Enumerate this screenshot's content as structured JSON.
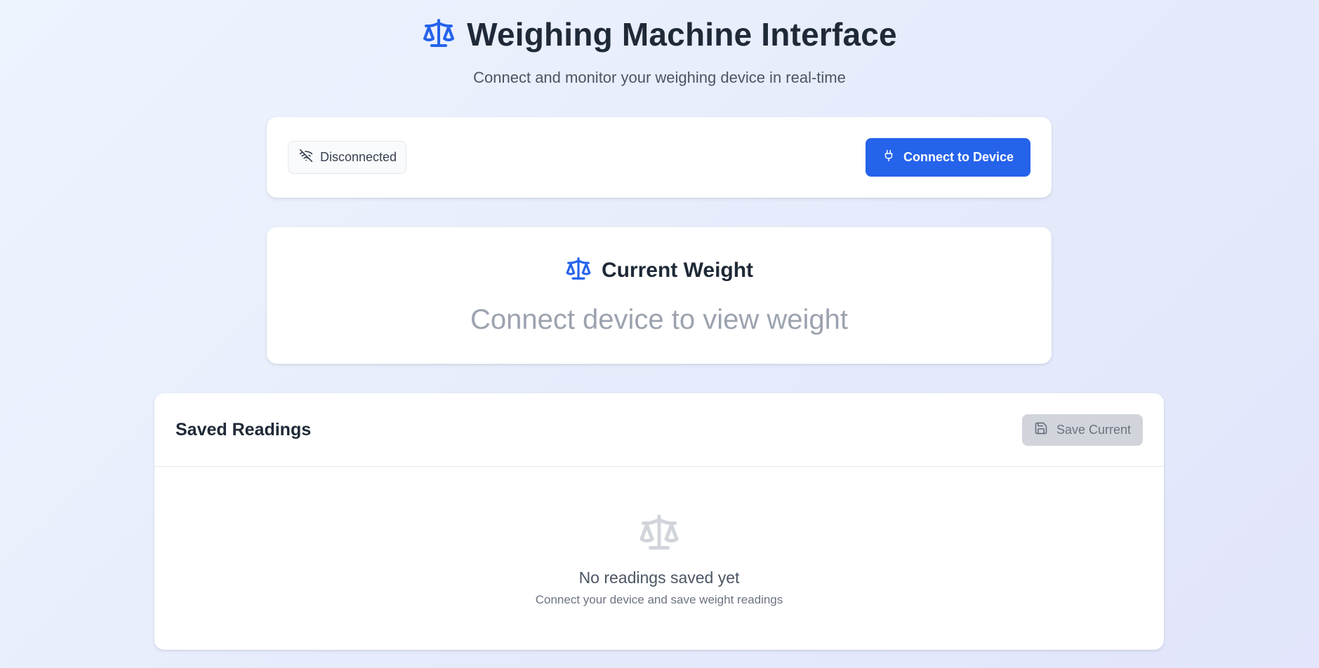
{
  "header": {
    "title": "Weighing Machine Interface",
    "subtitle": "Connect and monitor your weighing device in real-time",
    "icon": "scale-icon"
  },
  "connection": {
    "status": "Disconnected",
    "status_icon": "wifi-off-icon",
    "connect_label": "Connect to Device",
    "connect_icon": "plug-icon"
  },
  "weight": {
    "title": "Current Weight",
    "placeholder": "Connect device to view weight",
    "icon": "scale-icon"
  },
  "saved": {
    "title": "Saved Readings",
    "save_label": "Save Current",
    "save_icon": "save-icon",
    "empty_title": "No readings saved yet",
    "empty_subtitle": "Connect your device and save weight readings",
    "empty_icon": "scale-icon"
  },
  "colors": {
    "primary": "#2563eb",
    "disabled": "#d1d5db",
    "text": "#1f2937",
    "muted": "#9ca3af"
  }
}
